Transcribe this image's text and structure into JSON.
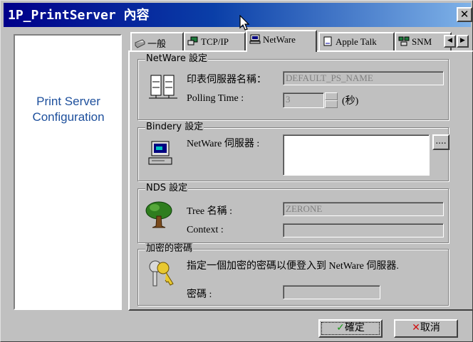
{
  "window": {
    "title": "1P_PrintServer 內容"
  },
  "left_panel": {
    "line1": "Print Server",
    "line2": "Configuration"
  },
  "tabs": [
    {
      "label": "一般",
      "icon": "printer-icon"
    },
    {
      "label": "TCP/IP",
      "icon": "network-icon"
    },
    {
      "label": "NetWare",
      "icon": "computer-icon"
    },
    {
      "label": "Apple Talk",
      "icon": "document-icon"
    },
    {
      "label": "SNM",
      "icon": "snmp-icon"
    }
  ],
  "tab_scroll": {
    "left": "◀",
    "right": "▶"
  },
  "netware_group": {
    "legend": "NetWare 設定",
    "server_name_label": "印表伺服器名稱：",
    "server_name_value": "DEFAULT_PS_NAME",
    "polling_label": "Polling Time :",
    "polling_value": "3",
    "polling_unit": "(秒)"
  },
  "bindery_group": {
    "legend": "Bindery 設定",
    "server_label": "NetWare 伺服器 :",
    "browse_label": "...."
  },
  "nds_group": {
    "legend": "NDS 設定",
    "tree_label": "Tree 名稱 :",
    "tree_value": "ZERONE",
    "context_label": "Context :"
  },
  "password_group": {
    "legend": "加密的密碼",
    "description": "指定一個加密的密碼以便登入到 NetWare 伺服器.",
    "password_label": "密碼 :"
  },
  "buttons": {
    "ok": "確定",
    "cancel": "取消"
  },
  "colors": {
    "title_start": "#00008a",
    "title_end": "#7fb2e8",
    "panel_text": "#1d4f9c"
  }
}
